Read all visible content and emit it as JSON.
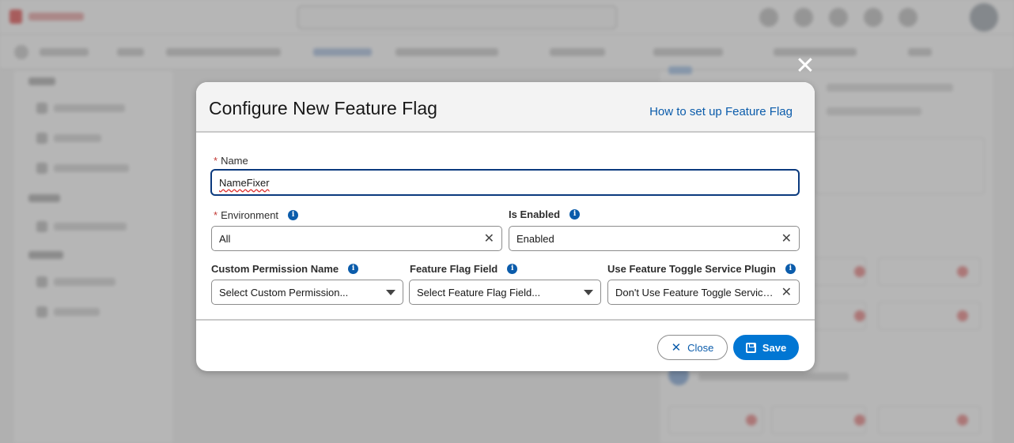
{
  "modal": {
    "title": "Configure New Feature Flag",
    "help_link": "How to set up Feature Flag",
    "close_icon": "close-icon",
    "fields": {
      "name": {
        "label": "Name",
        "required": "*",
        "value": "NameFixer"
      },
      "environment": {
        "label": "Environment",
        "required": "*",
        "value": "All"
      },
      "is_enabled": {
        "label": "Is Enabled",
        "value": "Enabled"
      },
      "custom_permission": {
        "label": "Custom Permission Name",
        "placeholder": "Select Custom Permission..."
      },
      "feature_flag_field": {
        "label": "Feature Flag Field",
        "placeholder": "Select Feature Flag Field..."
      },
      "toggle_service_plugin": {
        "label": "Use Feature Toggle Service Plugin",
        "value": "Don't Use Feature Toggle Service..."
      }
    },
    "buttons": {
      "close": "Close",
      "save": "Save"
    },
    "icons": {
      "info": "info-icon",
      "clear": "clear-icon",
      "dropdown": "chevron-down-icon",
      "save": "save-icon"
    }
  },
  "colors": {
    "accent": "#0176d3",
    "link": "#0b5cab",
    "required": "#c23934",
    "focus_border": "#0b3a7e"
  }
}
